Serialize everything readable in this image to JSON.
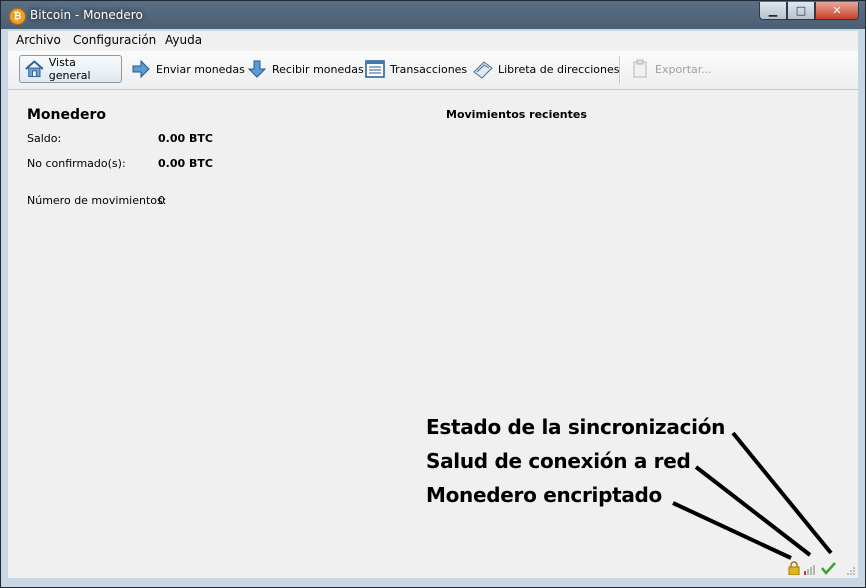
{
  "window": {
    "title": "Bitcoin - Monedero",
    "app_icon_glyph": "₿",
    "minimize_glyph": "▁",
    "maximize_glyph": "□",
    "close_glyph": "✕"
  },
  "menu": {
    "items": [
      {
        "label": "Archivo"
      },
      {
        "label": "Configuración"
      },
      {
        "label": "Ayuda"
      }
    ]
  },
  "toolbar": {
    "buttons": [
      {
        "label": "Vista general",
        "icon": "home-icon",
        "active": true
      },
      {
        "label": "Enviar monedas",
        "icon": "arrow-right-icon"
      },
      {
        "label": "Recibir monedas",
        "icon": "arrow-down-icon"
      },
      {
        "label": "Transacciones",
        "icon": "list-icon"
      },
      {
        "label": "Libreta de direcciones",
        "icon": "address-book-icon"
      },
      {
        "label": "Exportar...",
        "icon": "export-icon",
        "disabled": true
      }
    ]
  },
  "overview": {
    "title": "Monedero",
    "balance_label": "Saldo:",
    "balance_value": "0.00 BTC",
    "unconfirmed_label": "No confirmado(s):",
    "unconfirmed_value": "0.00 BTC",
    "tx_count_label": "Número de movimientos:",
    "tx_count_value": "0"
  },
  "recent": {
    "title": "Movimientos recientes"
  },
  "annotations": {
    "sync": "Estado de la sincronización",
    "network": "Salud de conexión a red",
    "encrypted": "Monedero encriptado"
  },
  "status_icons": [
    "lock-icon",
    "network-signal-icon",
    "sync-check-icon"
  ],
  "colors": {
    "title_bar": "#4b5f74",
    "lock": "#e7b416",
    "signal": "#c0392b",
    "check": "#3aa335"
  }
}
